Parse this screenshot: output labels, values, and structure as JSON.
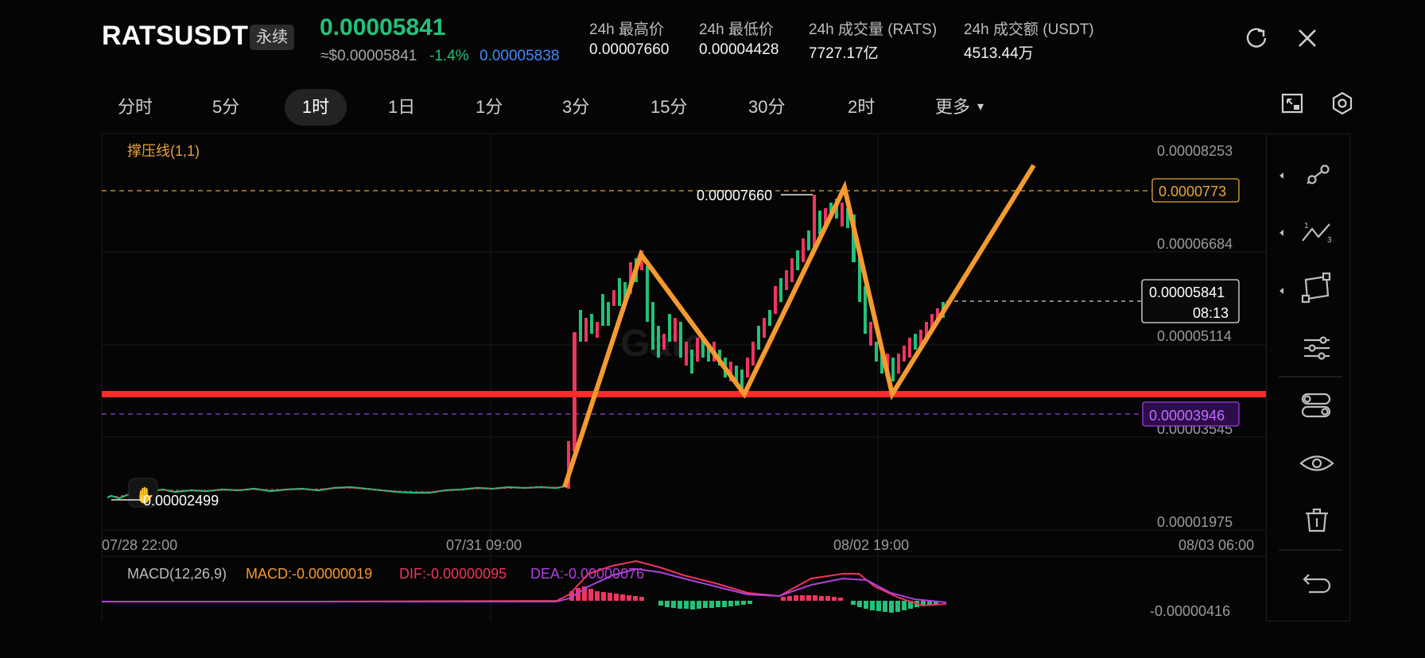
{
  "header": {
    "symbol": "RATSUSDT",
    "contract_type": "永续",
    "last_price": "0.00005841",
    "usd_price": "≈$0.00005841",
    "change_pct": "-1.4%",
    "mark_price": "0.00005838",
    "stats": [
      {
        "label": "24h 最高价",
        "value": "0.00007660"
      },
      {
        "label": "24h 最低价",
        "value": "0.00004428"
      },
      {
        "label": "24h 成交量 (RATS)",
        "value": "7727.17亿"
      },
      {
        "label": "24h 成交额 (USDT)",
        "value": "4513.44万"
      }
    ],
    "icons": [
      "refresh-icon",
      "close-icon"
    ]
  },
  "timeframes": {
    "items": [
      "分时",
      "5分",
      "1时",
      "1日",
      "1分",
      "3分",
      "15分",
      "30分",
      "2时",
      "更多"
    ],
    "active": "1时",
    "more_caret": "▾"
  },
  "toolbar_icons": [
    "fullscreen-icon",
    "settings-hex-icon"
  ],
  "chart": {
    "indicator_label": "撑压线(1,1)",
    "price_axis": [
      "0.00008253",
      "0.00006684",
      "0.00005114",
      "0.00003545",
      "0.00001975"
    ],
    "time_axis": [
      "07/28 22:00",
      "07/31 09:00",
      "08/02 19:00",
      "08/03 06:00"
    ],
    "high_marker": "0.00007660",
    "low_marker": "0.00002499",
    "resistance_tag": "0.0000773",
    "support_tag": "0.00003946",
    "current_price_tag": "0.00005841",
    "countdown": "08:13",
    "colors": {
      "up": "#21c17a",
      "down": "#f0345e",
      "resistance": "#e8a33c",
      "support": "#9b3fdc",
      "drawing": "#f59a2f",
      "red_line": "#ff2a2a"
    }
  },
  "macd": {
    "title": "MACD(12,26,9)",
    "macd": "MACD:-0.00000019",
    "dif": "DIF:-0.00000095",
    "dea": "DEA:-0.00000076",
    "axis_value": "-0.00000416",
    "colors": {
      "macd": "#f59a2f",
      "dif": "#f0345e",
      "dea": "#b040e0"
    }
  },
  "side_tools": [
    "trendline-tool-icon",
    "wave-tool-icon",
    "shape-tool-icon",
    "sliders-icon",
    "layers-settings-icon",
    "visibility-eye-icon",
    "trash-icon",
    "undo-icon"
  ]
}
